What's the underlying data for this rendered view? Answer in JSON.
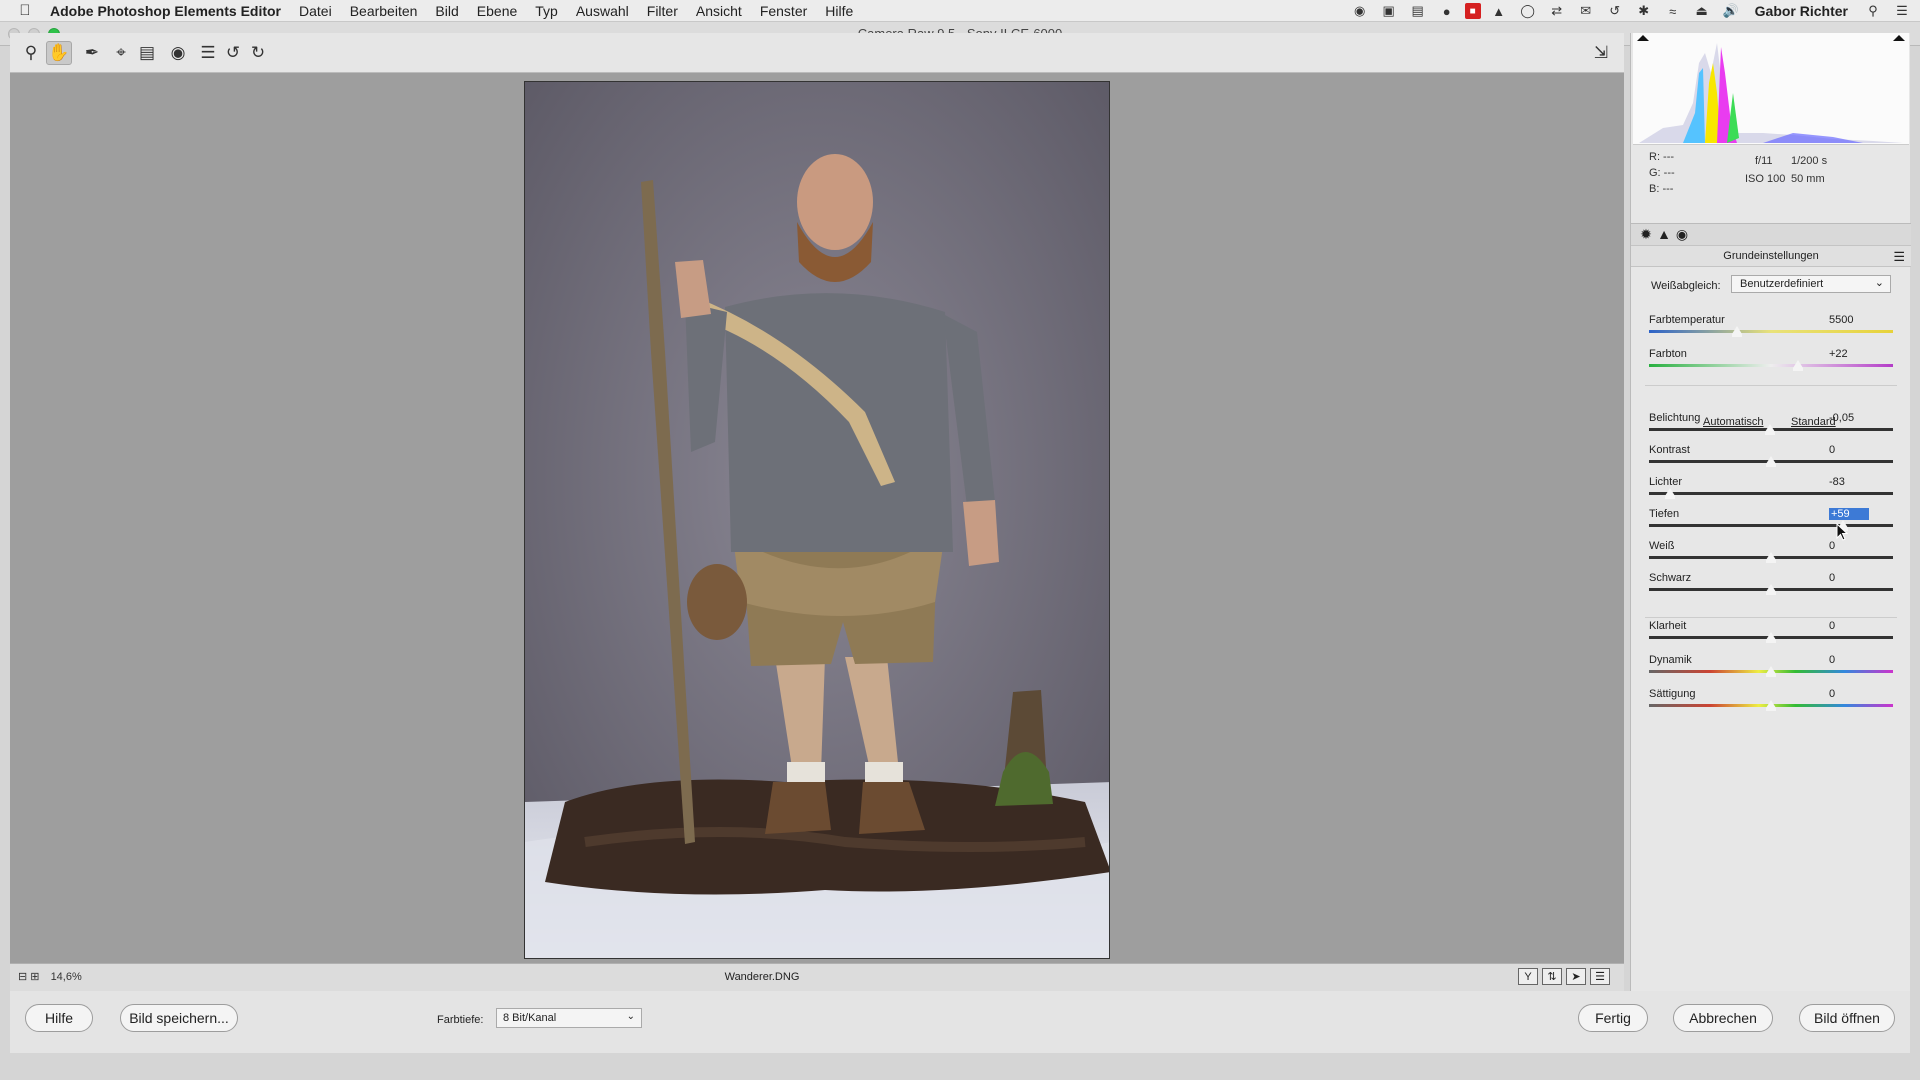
{
  "menubar": {
    "app_name": "Adobe Photoshop Elements Editor",
    "items": [
      "Datei",
      "Bearbeiten",
      "Bild",
      "Ebene",
      "Typ",
      "Auswahl",
      "Filter",
      "Ansicht",
      "Fenster",
      "Hilfe"
    ],
    "user": "Gabor Richter"
  },
  "window": {
    "title": "Camera Raw 9.5 - Sony ILCE-6000"
  },
  "toolbar": {
    "tools": [
      "zoom-icon",
      "hand-icon",
      "white-balance-icon",
      "crop-icon",
      "straighten-icon",
      "red-eye-icon",
      "preferences-icon",
      "rotate-left-icon",
      "rotate-right-icon"
    ],
    "active_tool": "hand-icon"
  },
  "preview": {
    "filename": "Wanderer.DNG",
    "zoom": "14,6%"
  },
  "camera_info": {
    "r": "R:  ---",
    "g": "G:  ---",
    "b": "B:  ---",
    "aperture": "f/11",
    "shutter": "1/200 s",
    "iso": "ISO 100",
    "focal": "50 mm"
  },
  "panel": {
    "section_title": "Grundeinstellungen",
    "wb_label": "Weißabgleich:",
    "wb_value": "Benutzerdefiniert",
    "auto_label": "Automatisch",
    "standard_label": "Standard",
    "sliders": [
      {
        "name": "Farbtemperatur",
        "value": "5500",
        "level": 0.36
      },
      {
        "name": "Farbton",
        "value": "+22",
        "level": 0.61
      },
      {
        "name": "Belichtung",
        "value": "-0,05",
        "level": 0.495
      },
      {
        "name": "Kontrast",
        "value": "0",
        "level": 0.5
      },
      {
        "name": "Lichter",
        "value": "-83",
        "level": 0.085
      },
      {
        "name": "Tiefen",
        "value": "+59",
        "level": 0.795
      },
      {
        "name": "Weiß",
        "value": "0",
        "level": 0.5
      },
      {
        "name": "Schwarz",
        "value": "0",
        "level": 0.5
      },
      {
        "name": "Klarheit",
        "value": "0",
        "level": 0.5
      },
      {
        "name": "Dynamik",
        "value": "0",
        "level": 0.5
      },
      {
        "name": "Sättigung",
        "value": "0",
        "level": 0.5
      }
    ]
  },
  "bottom": {
    "help": "Hilfe",
    "save": "Bild speichern...",
    "depth_label": "Farbtiefe:",
    "depth_value": "8 Bit/Kanal",
    "done": "Fertig",
    "cancel": "Abbrechen",
    "open": "Bild öffnen"
  },
  "colors": {
    "highlight": "#3d7ad6",
    "preview_bg": "#9e9e9e",
    "zoom_green": "#2fc24a"
  }
}
